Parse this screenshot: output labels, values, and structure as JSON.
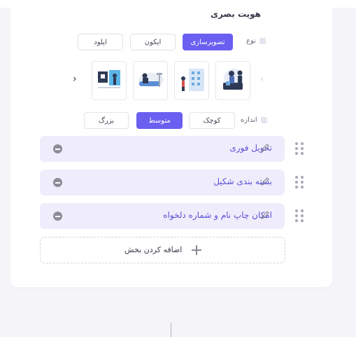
{
  "section": {
    "title": "هویت بصری"
  },
  "type_row": {
    "label": "نوع",
    "options": [
      {
        "label": "تصویرسازی",
        "active": true
      },
      {
        "label": "ایکون",
        "active": false
      },
      {
        "label": "اپلود",
        "active": false
      }
    ]
  },
  "gallery": {
    "items": [
      {
        "icon": "team-illustration-icon"
      },
      {
        "icon": "building-illustration-icon"
      },
      {
        "icon": "reading-illustration-icon"
      },
      {
        "icon": "notebook-illustration-icon"
      }
    ],
    "prev_icon": "‹",
    "next_icon": "›"
  },
  "size_row": {
    "label": "اندازه",
    "options": [
      {
        "label": "کوچک",
        "active": false
      },
      {
        "label": "متوسط",
        "active": true
      },
      {
        "label": "بزرگ",
        "active": false
      }
    ]
  },
  "features": [
    {
      "text": "تحویل فوری"
    },
    {
      "text": "بسته بندی شکیل"
    },
    {
      "text": "امکان چاپ نام و شماره دلخواه"
    }
  ],
  "add_section": {
    "label": "اضافه کردن بخش"
  },
  "colors": {
    "accent": "#6a5ff0",
    "feature_bg": "#efedfb",
    "feature_text": "#5a4fd8"
  }
}
